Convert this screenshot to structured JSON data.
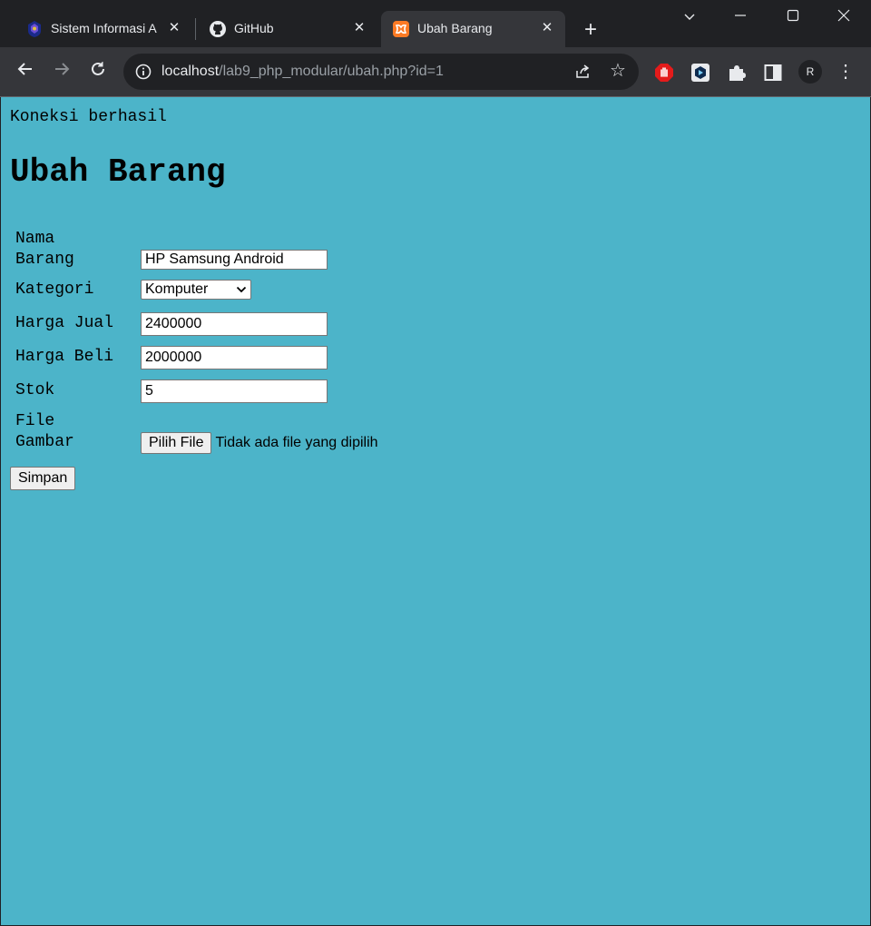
{
  "browser": {
    "tabs": [
      {
        "title": "Sistem Informasi A",
        "active": false
      },
      {
        "title": "GitHub",
        "active": false
      },
      {
        "title": "Ubah Barang",
        "active": true
      }
    ],
    "new_tab_symbol": "+",
    "url_host": "localhost",
    "url_path": "/lab9_php_modular/ubah.php?id=1",
    "profile_initial": "R",
    "accent_active_tab": "#35363a",
    "frame_color": "#202124"
  },
  "page": {
    "background": "#4cb4c9",
    "status_text": "Koneksi berhasil",
    "title": "Ubah Barang",
    "form": {
      "fields": [
        {
          "label_line1": "Nama",
          "label_line2": "Barang",
          "value": "HP Samsung Android"
        },
        {
          "label": "Kategori",
          "selected": "Komputer"
        },
        {
          "label": "Harga Jual",
          "value": "2400000"
        },
        {
          "label": "Harga Beli",
          "value": "2000000"
        },
        {
          "label": "Stok",
          "value": "5"
        },
        {
          "label_line1": "File",
          "label_line2": "Gambar",
          "button": "Pilih File",
          "status": "Tidak ada file yang dipilih"
        }
      ],
      "submit_label": "Simpan"
    }
  }
}
